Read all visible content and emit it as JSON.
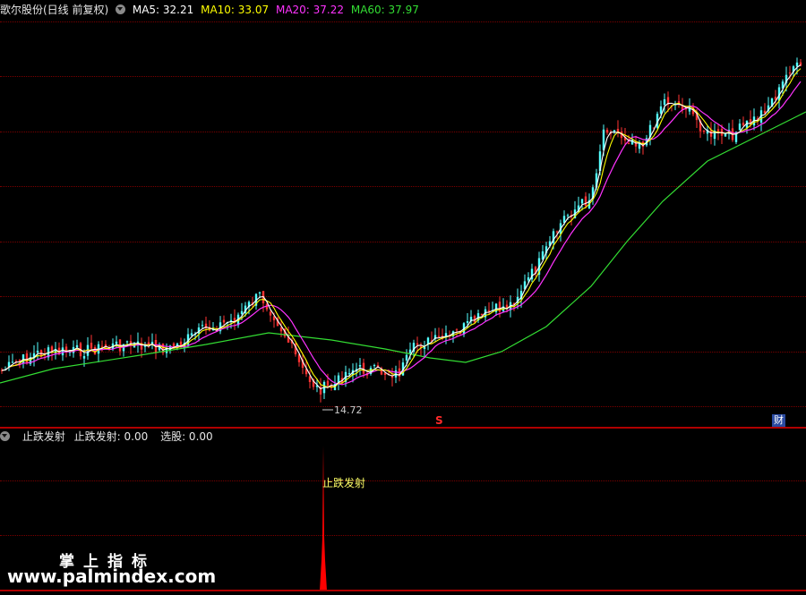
{
  "header": {
    "stock_title": "歌尔股份(日线 前复权)",
    "ma5": "MA5: 32.21",
    "ma10": "MA10: 33.07",
    "ma20": "MA20: 37.22",
    "ma60": "MA60: 37.97"
  },
  "price_panel": {
    "low_label": "14.72",
    "mark_s": "S",
    "mark_cai": "财"
  },
  "indicator": {
    "name": "止跌发射",
    "value1": "止跌发射: 0.00",
    "value2": "选股: 0.00",
    "signal_label": "止跌发射"
  },
  "watermark": {
    "line1": "掌上指标",
    "line2": "www.palmindex.com"
  },
  "colors": {
    "up": "#54ffff",
    "down": "#ff3333",
    "ma5": "#ffffff",
    "ma10": "#ffff00",
    "ma20": "#ff33ff",
    "ma60": "#33dd33",
    "grid": "#7a0000",
    "signal": "#ff0000"
  },
  "chart_data": {
    "type": "line",
    "series": [
      {
        "name": "MA5",
        "values": [
          32.21
        ]
      },
      {
        "name": "MA10",
        "values": [
          33.07
        ]
      },
      {
        "name": "MA20",
        "values": [
          37.22
        ]
      },
      {
        "name": "MA60",
        "values": [
          37.97
        ]
      }
    ],
    "annotations": [
      "14.72"
    ]
  }
}
